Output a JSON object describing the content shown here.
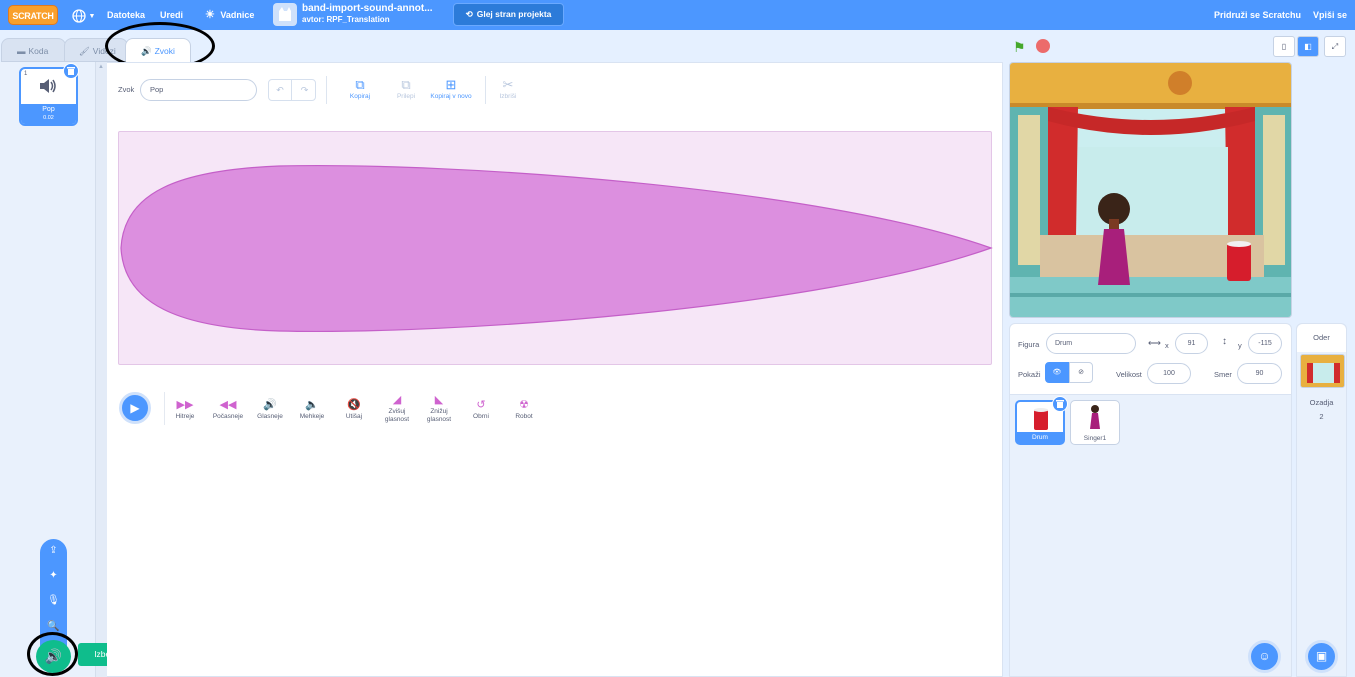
{
  "menubar": {
    "logo": "SCRATCH",
    "file": "Datoteka",
    "edit": "Uredi",
    "tutorials": "Vadnice",
    "project_title": "band-import-sound-annot...",
    "author": "avtor: RPF_Translation",
    "see_project": "Glej stran projekta",
    "join": "Pridruži se Scratchu",
    "signin": "Vpiši se",
    "bg_color": "#4c97ff"
  },
  "tabs": [
    {
      "label": "Koda",
      "icon": "code-icon"
    },
    {
      "label": "Videzi",
      "icon": "brush-icon"
    },
    {
      "label": "Zvoki",
      "icon": "speaker-icon"
    }
  ],
  "sound_list": [
    {
      "index": "1",
      "name": "Pop",
      "duration": "0.02"
    }
  ],
  "add_sound": {
    "tooltip": "Izberi zvok",
    "options": [
      "upload-icon",
      "surprise-icon",
      "record-icon",
      "search-icon"
    ]
  },
  "editor": {
    "sound_label": "Zvok",
    "sound_name": "Pop",
    "tools": [
      "Kopiraj",
      "Prilepi",
      "Kopiraj v novo",
      "Izbriši"
    ],
    "waveform_color": "#cf63cf",
    "effects": [
      {
        "label": "Hitreje",
        "icon": "faster-icon"
      },
      {
        "label": "Počasneje",
        "icon": "slower-icon"
      },
      {
        "label": "Glasneje",
        "icon": "louder-icon"
      },
      {
        "label": "Mehkeje",
        "icon": "softer-icon"
      },
      {
        "label": "Utišaj",
        "icon": "mute-icon"
      },
      {
        "label": "Zvišuj glasnost",
        "icon": "fade-in-icon"
      },
      {
        "label": "Znižuj glasnost",
        "icon": "fade-out-icon"
      },
      {
        "label": "Obrni",
        "icon": "reverse-icon"
      },
      {
        "label": "Robot",
        "icon": "robot-icon"
      }
    ]
  },
  "sprite_info": {
    "sprite_label": "Figura",
    "sprite_name": "Drum",
    "x_label": "x",
    "x": "91",
    "y_label": "y",
    "y": "-115",
    "show_label": "Pokaži",
    "size_label": "Velikost",
    "size": "100",
    "direction_label": "Smer",
    "direction": "90"
  },
  "sprites": [
    {
      "name": "Drum",
      "selected": true
    },
    {
      "name": "Singer1",
      "selected": false
    }
  ],
  "backdrop_panel": {
    "title": "Oder",
    "label": "Ozadja",
    "count": "2"
  }
}
